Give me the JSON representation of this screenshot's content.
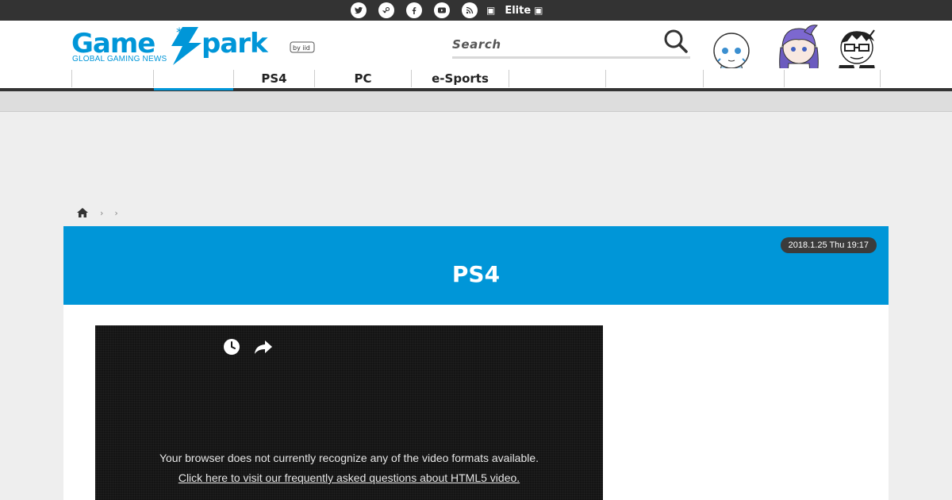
{
  "topbar": {
    "tagline": "",
    "social_icons": [
      "twitter-icon",
      "steam-icon",
      "facebook-icon",
      "youtube-icon",
      "rss-icon"
    ],
    "elite_label": "Elite",
    "elite_mark": ""
  },
  "header": {
    "logo_text": "Game*Spark",
    "logo_sub": "GLOBAL GAMING NEWS",
    "logo_byline": "by iid",
    "search_placeholder": "Search",
    "mascots": [
      "mascot-robot",
      "mascot-girl",
      "mascot-glasses-man"
    ]
  },
  "nav": {
    "items": [
      {
        "label": ""
      },
      {
        "label": "",
        "active": true
      },
      {
        "label": "PS4"
      },
      {
        "label": "PC"
      },
      {
        "label": "e-Sports"
      },
      {
        "label": ""
      },
      {
        "label": ""
      },
      {
        "label": ""
      },
      {
        "label": ""
      }
    ]
  },
  "breadcrumb": {
    "items": [
      "home-icon",
      "",
      ""
    ]
  },
  "article": {
    "date": "2018.1.25 Thu 19:17",
    "title": "PS4"
  },
  "video": {
    "message": "Your browser does not currently recognize any of the video formats available.",
    "link_text": "Click here to visit our frequently asked questions about HTML5 video."
  },
  "colors": {
    "accent": "#0096d8",
    "topbar": "#333333",
    "badge": "#3b3b3b"
  }
}
